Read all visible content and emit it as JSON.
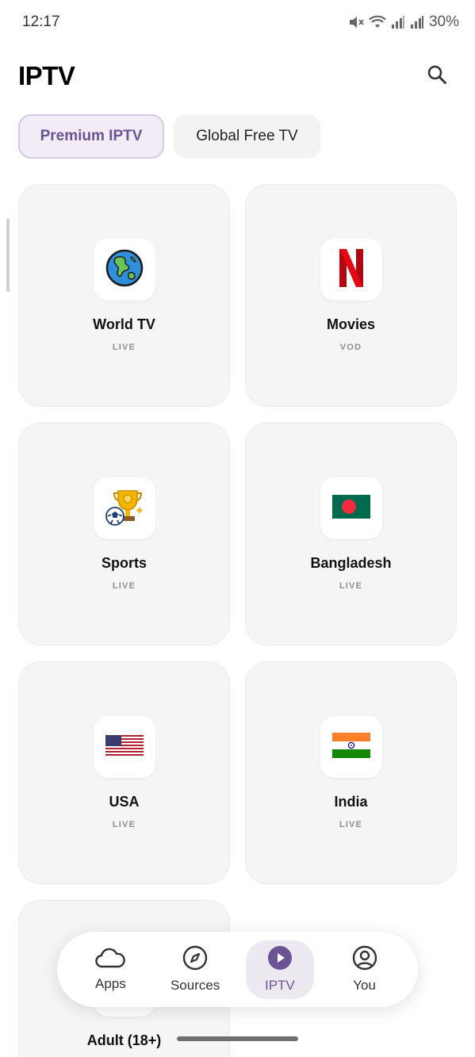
{
  "status_bar": {
    "time": "12:17",
    "battery": "30%",
    "icons": [
      "mute-icon",
      "wifi-icon",
      "signal-icon",
      "signal-icon"
    ]
  },
  "header": {
    "title": "IPTV",
    "search_icon": "search-icon"
  },
  "tabs": [
    {
      "label": "Premium IPTV",
      "active": true
    },
    {
      "label": "Global Free TV",
      "active": false
    }
  ],
  "cards": [
    {
      "title": "World TV",
      "subtitle": "LIVE",
      "icon": "globe-icon"
    },
    {
      "title": "Movies",
      "subtitle": "VOD",
      "icon": "netflix-logo-icon"
    },
    {
      "title": "Sports",
      "subtitle": "LIVE",
      "icon": "trophy-icon"
    },
    {
      "title": "Bangladesh",
      "subtitle": "LIVE",
      "icon": "bangladesh-flag-icon"
    },
    {
      "title": "USA",
      "subtitle": "LIVE",
      "icon": "usa-flag-icon"
    },
    {
      "title": "India",
      "subtitle": "LIVE",
      "icon": "india-flag-icon"
    },
    {
      "title": "Adult (18+)",
      "subtitle": "",
      "icon": "adult-icon"
    }
  ],
  "bottom_nav": [
    {
      "label": "Apps",
      "icon": "cloud-icon",
      "active": false
    },
    {
      "label": "Sources",
      "icon": "compass-icon",
      "active": false
    },
    {
      "label": "IPTV",
      "icon": "play-circle-icon",
      "active": true
    },
    {
      "label": "You",
      "icon": "account-icon",
      "active": false
    }
  ],
  "colors": {
    "accent": "#6a5496",
    "accent_bg": "#f1ecf6",
    "card_bg": "#f5f5f5"
  }
}
